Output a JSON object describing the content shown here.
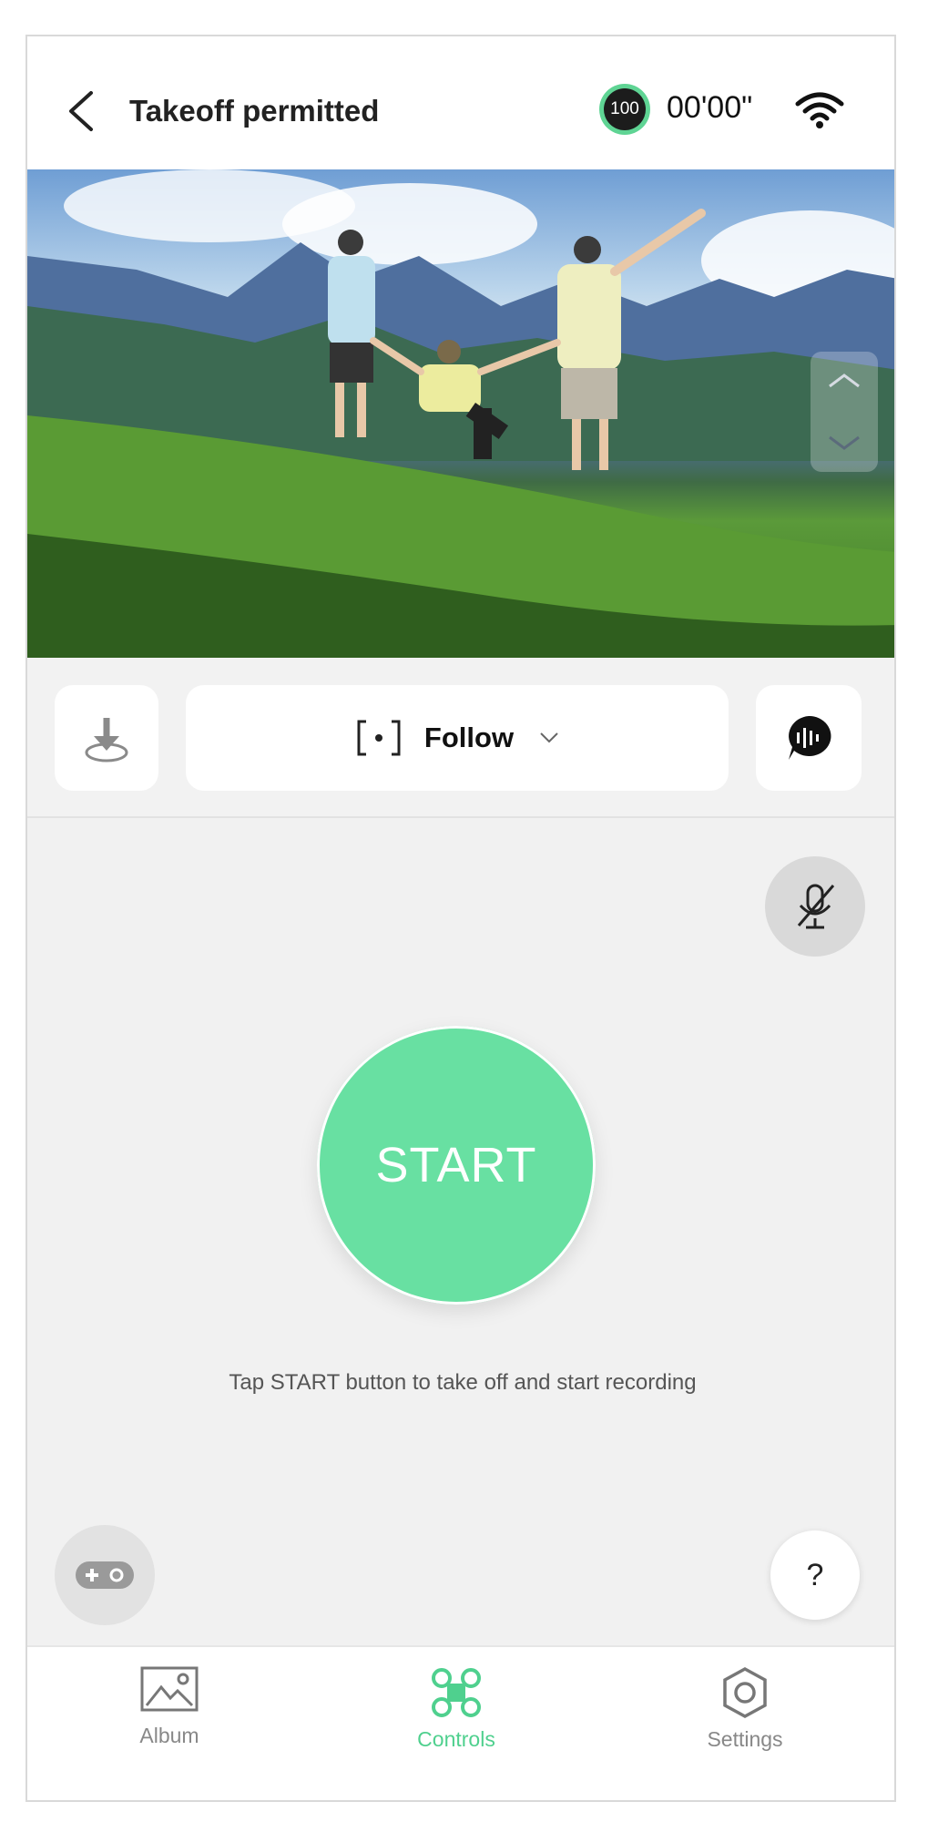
{
  "header": {
    "title": "Takeoff permitted",
    "battery": "100",
    "flight_time": "00'00\""
  },
  "mode": {
    "label": "Follow"
  },
  "main": {
    "start_label": "START",
    "hint": "Tap START button to take off and start recording",
    "help_label": "?"
  },
  "nav": {
    "items": [
      {
        "label": "Album",
        "icon": "image-icon"
      },
      {
        "label": "Controls",
        "icon": "drone-icon",
        "active": true
      },
      {
        "label": "Settings",
        "icon": "hexagon-settings-icon"
      }
    ]
  },
  "colors": {
    "accent": "#68e0a2",
    "active_nav": "#4fd08e",
    "battery_ring": "#5fd494"
  }
}
